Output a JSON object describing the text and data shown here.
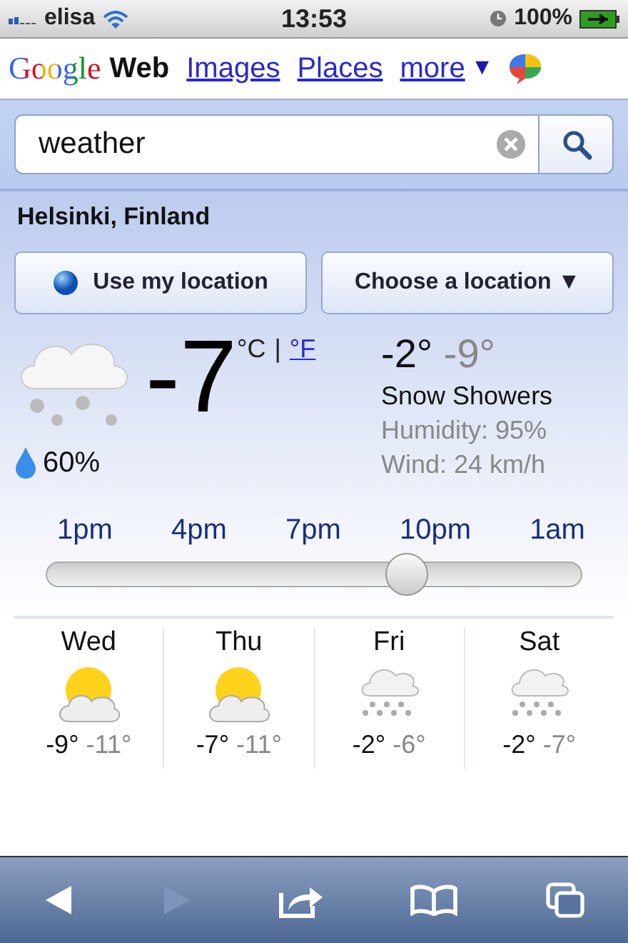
{
  "status_bar": {
    "carrier": "elisa",
    "time": "13:53",
    "battery": "100%"
  },
  "nav": {
    "logo": "Google",
    "tabs": [
      {
        "label": "Web",
        "selected": true
      },
      {
        "label": "Images",
        "selected": false
      },
      {
        "label": "Places",
        "selected": false
      },
      {
        "label": "more",
        "selected": false
      }
    ],
    "more_caret": "▼"
  },
  "search": {
    "value": "weather"
  },
  "location": "Helsinki, Finland",
  "location_buttons": [
    {
      "kind": "globe",
      "label": "Use my location"
    },
    {
      "kind": "dropdown",
      "label": "Choose a location ▼"
    }
  ],
  "current": {
    "temperature": "-7",
    "units": [
      {
        "label": "°C",
        "selected": true
      },
      {
        "label": "°F",
        "selected": false
      }
    ],
    "unit_separator": "|",
    "precipitation": "60%",
    "high": "-2°",
    "low": "-9°",
    "condition": "Snow Showers",
    "humidity": "Humidity: 95%",
    "wind": "Wind: 24 km/h"
  },
  "hours": [
    "1pm",
    "4pm",
    "7pm",
    "10pm",
    "1am"
  ],
  "time_slider": {
    "level": 0.67
  },
  "forecast": [
    {
      "day": "Wed",
      "kind": "sun-cloud",
      "high": "-9°",
      "low": "-11°"
    },
    {
      "day": "Thu",
      "kind": "sun-cloud",
      "high": "-7°",
      "low": "-11°"
    },
    {
      "day": "Fri",
      "kind": "snow",
      "high": "-2°",
      "low": "-6°"
    },
    {
      "day": "Sat",
      "kind": "snow",
      "high": "-2°",
      "low": "-7°"
    }
  ],
  "toolbar": [
    {
      "kind": "back",
      "disabled": false
    },
    {
      "kind": "forward",
      "disabled": true
    },
    {
      "kind": "share",
      "disabled": false
    },
    {
      "kind": "bookmarks",
      "disabled": false
    },
    {
      "kind": "tabs",
      "disabled": false
    }
  ]
}
